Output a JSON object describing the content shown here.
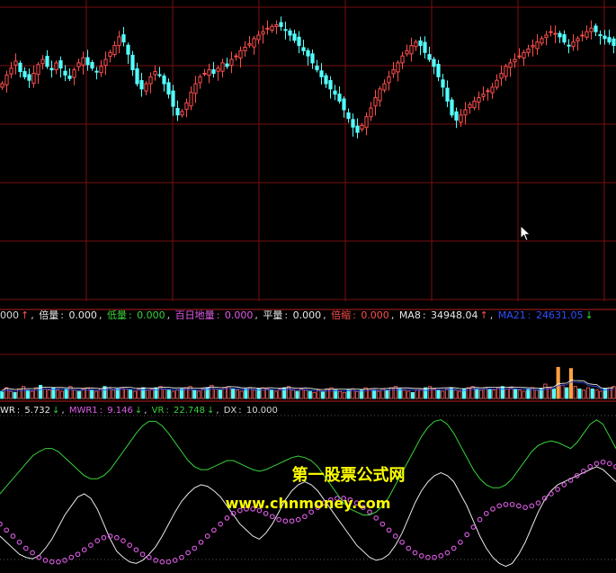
{
  "colors": {
    "background": "#000000",
    "grid": "#7a0f0f",
    "up": "#ff4e4e",
    "down": "#54ffff",
    "volume_up": "#ff6464",
    "volume_down": "#54ffff",
    "volume_highlight": "#ffa040",
    "wr": "#e9e9e9",
    "mwr1": "#e05ce8",
    "vr": "#38d238",
    "dx": "#d8d8d8",
    "ma8": "#ffffff",
    "ma21": "#3050ff",
    "watermark": "#ffff00"
  },
  "volume_info": {
    "prefix": "000",
    "prefix_arrow": "↑",
    "bei_label": "倍量",
    "bei_value": "0.000",
    "di_label": "低量",
    "di_value": "0.000",
    "bai_label": "百日地量",
    "bai_value": "0.000",
    "ping_label": "平量",
    "ping_value": "0.000",
    "suo_label": "倍缩",
    "suo_value": "0.000",
    "ma8_label": "MA8",
    "ma8_value": "34948.04",
    "ma8_arrow": "↑",
    "ma21_label": "MA21",
    "ma21_value": "24631.05",
    "ma21_arrow": "↓"
  },
  "indicator_info": {
    "wr_label": "WR",
    "wr_value": "5.732",
    "wr_arrow": "↓",
    "mwr1_label": "MWR1",
    "mwr1_value": "9.146",
    "mwr1_arrow": "↓",
    "vr_label": "VR",
    "vr_value": "22.748",
    "vr_arrow": "↓",
    "dx_label": "DX",
    "dx_value": "10.000"
  },
  "watermark": {
    "line1": "第一股票公式网",
    "line2": "www.chnmoney.com"
  },
  "chart_data": [
    {
      "type": "candlestick",
      "panel": "price",
      "ylim": [
        0,
        100
      ],
      "grid": true,
      "closes": [
        58,
        63,
        67,
        71,
        65,
        62,
        60,
        64,
        69,
        72,
        68,
        66,
        70,
        67,
        63,
        61,
        66,
        70,
        73,
        69,
        67,
        65,
        68,
        72,
        76,
        80,
        85,
        82,
        75,
        66,
        58,
        55,
        58,
        62,
        65,
        63,
        58,
        52,
        45,
        40,
        42,
        47,
        53,
        58,
        62,
        64,
        66,
        64,
        67,
        70,
        68,
        72,
        74,
        77,
        79,
        81,
        84,
        86,
        88,
        90,
        91,
        92,
        91,
        89,
        86,
        83,
        80,
        77,
        74,
        70,
        66,
        62,
        58,
        55,
        52,
        48,
        43,
        38,
        33,
        30,
        34,
        39,
        44,
        50,
        55,
        58,
        62,
        66,
        70,
        74,
        77,
        80,
        82,
        80,
        76,
        72,
        68,
        62,
        56,
        48,
        40,
        37,
        40,
        43,
        46,
        48,
        50,
        52,
        54,
        56,
        60,
        64,
        68,
        70,
        72,
        74,
        76,
        78,
        80,
        82,
        84,
        86,
        88,
        87,
        85,
        82,
        80,
        82,
        84,
        86,
        88,
        90,
        88,
        86,
        84,
        82,
        80
      ]
    },
    {
      "type": "bar",
      "panel": "volume",
      "ylim": [
        0,
        30
      ],
      "values": [
        6,
        9,
        6,
        5,
        8,
        10,
        7,
        6,
        9,
        11,
        8,
        7,
        9,
        7,
        6,
        8,
        10,
        7,
        6,
        8,
        9,
        7,
        6,
        8,
        10,
        9,
        7,
        8,
        9,
        8,
        7,
        6,
        8,
        9,
        7,
        8,
        9,
        10,
        8,
        7,
        6,
        7,
        8,
        9,
        10,
        7,
        6,
        8,
        9,
        11,
        8,
        7,
        9,
        10,
        8,
        7,
        6,
        8,
        9,
        7,
        8,
        9,
        8,
        7,
        6,
        8,
        9,
        10,
        7,
        6,
        8,
        7,
        6,
        5,
        7,
        6,
        8,
        9,
        7,
        6,
        5,
        7,
        8,
        6,
        7,
        9,
        8,
        7,
        6,
        8,
        7,
        9,
        10,
        8,
        7,
        6,
        5,
        7,
        8,
        9,
        10,
        8,
        7,
        6,
        8,
        9,
        7,
        6,
        8,
        9,
        10,
        8,
        7,
        9,
        8,
        7,
        9,
        10,
        8,
        9,
        8,
        7,
        6,
        8,
        9,
        7,
        8,
        12,
        9,
        8,
        26,
        11,
        9,
        25,
        10,
        8,
        7,
        9,
        8,
        7,
        6,
        8,
        9,
        10
      ]
    },
    {
      "type": "line",
      "panel": "indicator",
      "ylim": [
        0,
        100
      ],
      "series": [
        {
          "name": "WR",
          "values": [
            22,
            18,
            14,
            10,
            8,
            7,
            9,
            14,
            20,
            28,
            36,
            42,
            48,
            50,
            47,
            40,
            30,
            20,
            12,
            8,
            5,
            4,
            6,
            10,
            15,
            22,
            30,
            38,
            45,
            50,
            54,
            56,
            55,
            52,
            48,
            42,
            36,
            30,
            26,
            22,
            20,
            24,
            30,
            38,
            46,
            52,
            56,
            58,
            56,
            52,
            46,
            40,
            34,
            28,
            22,
            16,
            12,
            8,
            6,
            7,
            10,
            16,
            24,
            34,
            44,
            52,
            58,
            62,
            64,
            62,
            58,
            50,
            42,
            32,
            22,
            14,
            8,
            4,
            2,
            4,
            10,
            18,
            28,
            38,
            46,
            52,
            56,
            58,
            60,
            62,
            64,
            66,
            68,
            66,
            62,
            58
          ]
        },
        {
          "name": "MWR1",
          "values": [
            30,
            26,
            22,
            18,
            14,
            11,
            8,
            6,
            5,
            5,
            6,
            8,
            10,
            13,
            16,
            19,
            21,
            22,
            21,
            19,
            16,
            13,
            10,
            8,
            6,
            5,
            5,
            6,
            8,
            11,
            14,
            18,
            22,
            26,
            30,
            34,
            37,
            39,
            40,
            40,
            39,
            37,
            35,
            33,
            32,
            32,
            33,
            35,
            38,
            41,
            44,
            46,
            47,
            47,
            46,
            44,
            41,
            38,
            34,
            30,
            26,
            22,
            18,
            14,
            11,
            9,
            8,
            8,
            9,
            11,
            14,
            18,
            23,
            28,
            33,
            37,
            40,
            42,
            43,
            43,
            42,
            41,
            42,
            44,
            47,
            50,
            53,
            56,
            59,
            62,
            65,
            68,
            70,
            71,
            70,
            68
          ]
        },
        {
          "name": "VR",
          "values": [
            50,
            55,
            60,
            65,
            70,
            75,
            78,
            80,
            80,
            78,
            74,
            70,
            66,
            62,
            60,
            60,
            62,
            66,
            72,
            78,
            84,
            90,
            95,
            98,
            98,
            95,
            90,
            84,
            78,
            72,
            68,
            66,
            66,
            68,
            70,
            72,
            72,
            70,
            68,
            66,
            65,
            66,
            68,
            70,
            72,
            74,
            75,
            74,
            72,
            68,
            62,
            56,
            50,
            44,
            40,
            38,
            36,
            36,
            38,
            42,
            48,
            56,
            64,
            72,
            80,
            88,
            94,
            98,
            99,
            96,
            90,
            82,
            74,
            66,
            60,
            56,
            54,
            54,
            56,
            60,
            66,
            72,
            78,
            82,
            84,
            85,
            84,
            82,
            80,
            84,
            90,
            96,
            99,
            96,
            88,
            80
          ]
        }
      ]
    }
  ]
}
